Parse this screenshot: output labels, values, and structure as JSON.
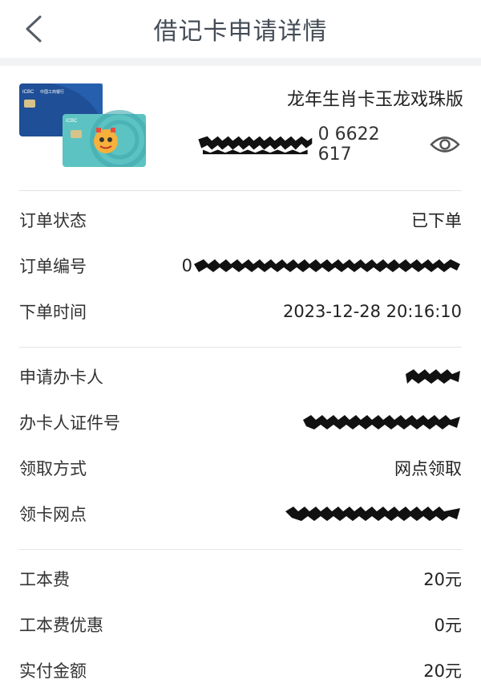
{
  "header": {
    "title": "借记卡申请详情"
  },
  "card": {
    "name": "龙年生肖卡玉龙戏珠版",
    "number_prefix_masked": "",
    "number_suffix": "0 6622 617",
    "front_bank_label": "ICBC 中国工商银行",
    "back_bank_label": "ICBC"
  },
  "order": {
    "status_label": "订单状态",
    "status_value": "已下单",
    "number_label": "订单编号",
    "number_prefix": "0",
    "time_label": "下单时间",
    "time_value": "2023-12-28 20:16:10"
  },
  "applicant": {
    "name_label": "申请办卡人",
    "id_label": "办卡人证件号",
    "method_label": "领取方式",
    "method_value": "网点领取",
    "branch_label": "领卡网点"
  },
  "fees": {
    "cost_label": "工本费",
    "cost_value": "20元",
    "discount_label": "工本费优惠",
    "discount_value": "0元",
    "paid_label": "实付金额",
    "paid_value": "20元"
  },
  "colors": {
    "header_text": "#444c56",
    "divider": "#e4e4e4",
    "card_blue": "#1f4f96",
    "card_teal": "#5cc3c2"
  }
}
